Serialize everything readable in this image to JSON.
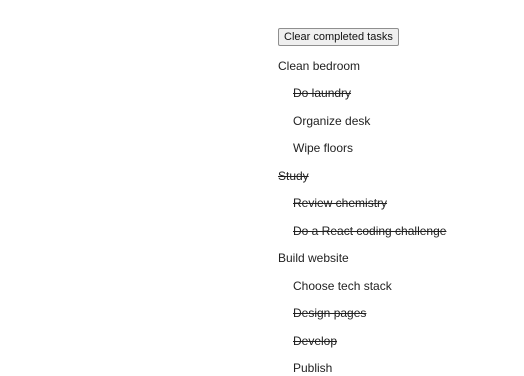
{
  "toolbar": {
    "clear_label": "Clear completed tasks"
  },
  "tasks": [
    {
      "label": "Clean bedroom",
      "completed": false,
      "level": 0
    },
    {
      "label": "Do laundry",
      "completed": true,
      "level": 1
    },
    {
      "label": "Organize desk",
      "completed": false,
      "level": 1
    },
    {
      "label": "Wipe floors",
      "completed": false,
      "level": 1
    },
    {
      "label": "Study",
      "completed": true,
      "level": 0
    },
    {
      "label": "Review chemistry",
      "completed": true,
      "level": 1
    },
    {
      "label": "Do a React coding challenge",
      "completed": true,
      "level": 1
    },
    {
      "label": "Build website",
      "completed": false,
      "level": 0
    },
    {
      "label": "Choose tech stack",
      "completed": false,
      "level": 1
    },
    {
      "label": "Design pages",
      "completed": true,
      "level": 1
    },
    {
      "label": "Develop",
      "completed": true,
      "level": 1
    },
    {
      "label": "Publish",
      "completed": false,
      "level": 1
    }
  ]
}
